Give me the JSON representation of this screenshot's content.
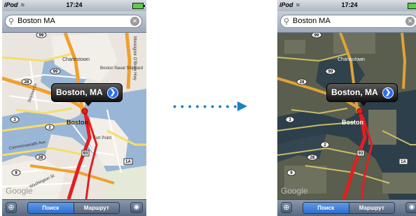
{
  "left": {
    "statusbar": {
      "carrier": "iPod",
      "time": "17:24"
    },
    "search": {
      "query": "Boston MA"
    },
    "map": {
      "labels": {
        "charlestown": "Charlestown",
        "navy_yard": "Boston Naval Shipyard",
        "boston": "Boston",
        "fort_point": "Fort Point",
        "commonwealth": "Commonwealth Ave",
        "google": "Google",
        "washington": "Washington St",
        "storrow": "Storrow Dr",
        "monsignor": "Monsignor O'Brien Hwy",
        "route_99": "99",
        "route_93": "93",
        "route_28a": "28",
        "route_28b": "28",
        "route_3": "3",
        "route_2": "2",
        "route_9": "9",
        "route_1a": "1A"
      },
      "callout": {
        "title": "Boston, MA"
      },
      "style": "map"
    },
    "toolbar": {
      "search_label": "Поиск",
      "route_label": "Маршрут"
    }
  },
  "right": {
    "statusbar": {
      "carrier": "iPod",
      "time": "17:24"
    },
    "search": {
      "query": "Boston MA"
    },
    "map": {
      "labels": {
        "charlestown": "Charlestown",
        "boston": "Boston",
        "google": "Google",
        "route_99": "99",
        "route_93": "93",
        "route_28a": "28",
        "route_28b": "28",
        "route_3": "3",
        "route_2": "2",
        "route_9": "9",
        "route_1a": "1A"
      },
      "callout": {
        "title": "Boston, MA"
      },
      "style": "satellite"
    },
    "toolbar": {
      "search_label": "Поиск",
      "route_label": "Маршрут"
    }
  },
  "arrow": {
    "dots": "• • • • • • • • •",
    "color": "#1a7fc5"
  },
  "icons": {
    "locate": "crosshair-icon",
    "page_curl": "eye-icon",
    "search": "magnifier-icon",
    "clear": "clear-icon",
    "wifi": "wifi-icon",
    "battery": "battery-icon",
    "disclosure": "disclosure-arrow-icon"
  }
}
